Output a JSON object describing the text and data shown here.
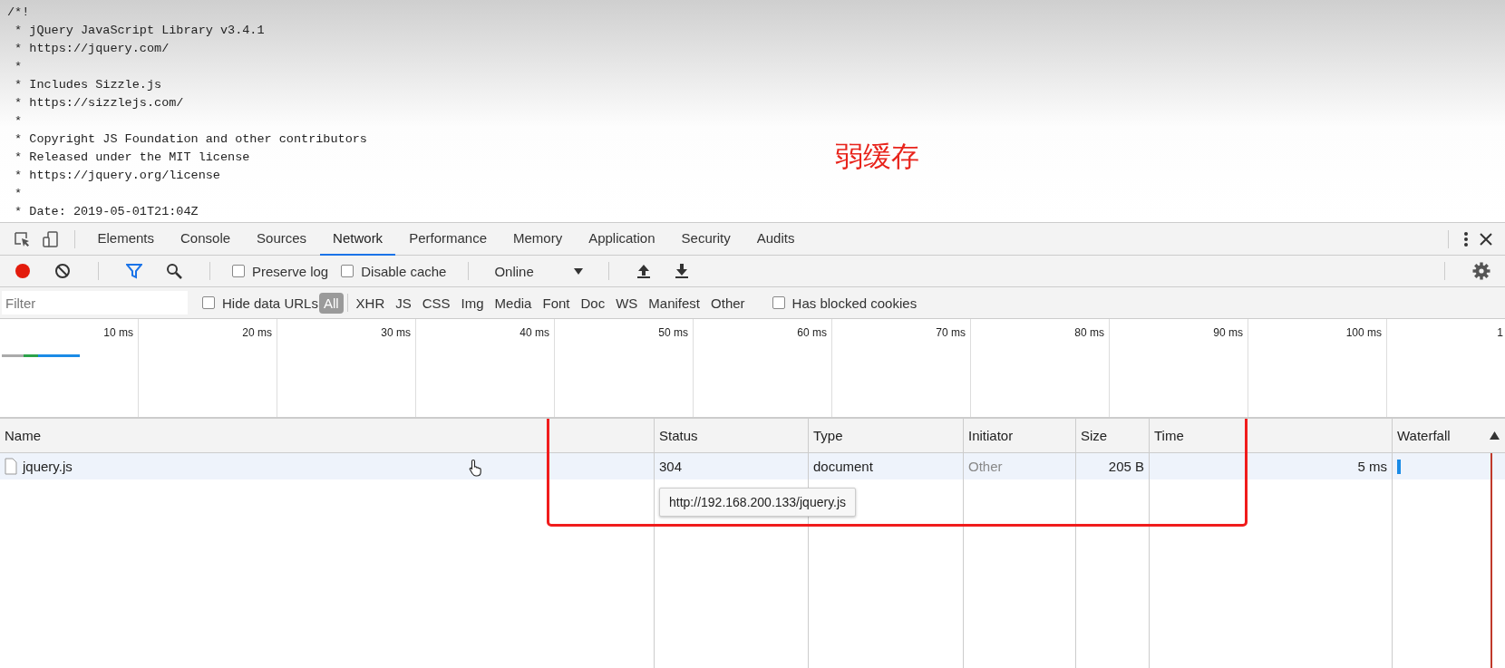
{
  "source": {
    "lines": [
      "/*!",
      " * jQuery JavaScript Library v3.4.1",
      " * https://jquery.com/",
      " *",
      " * Includes Sizzle.js",
      " * https://sizzlejs.com/",
      " *",
      " * Copyright JS Foundation and other contributors",
      " * Released under the MIT license",
      " * https://jquery.org/license",
      " *",
      " * Date: 2019-05-01T21:04Z"
    ]
  },
  "annotation": {
    "text": "弱缓存"
  },
  "devtools": {
    "tabs": [
      {
        "label": "Elements",
        "selected": false
      },
      {
        "label": "Console",
        "selected": false
      },
      {
        "label": "Sources",
        "selected": false
      },
      {
        "label": "Network",
        "selected": true
      },
      {
        "label": "Performance",
        "selected": false
      },
      {
        "label": "Memory",
        "selected": false
      },
      {
        "label": "Application",
        "selected": false
      },
      {
        "label": "Security",
        "selected": false
      },
      {
        "label": "Audits",
        "selected": false
      }
    ],
    "toolbar": {
      "recording": true,
      "preserve_log": {
        "label": "Preserve log",
        "checked": false
      },
      "disable_cache": {
        "label": "Disable cache",
        "checked": false
      },
      "throttling": "Online"
    },
    "filter": {
      "placeholder": "Filter",
      "hide_data_urls": {
        "label": "Hide data URLs",
        "checked": false
      },
      "types": [
        {
          "label": "All",
          "selected": true
        },
        {
          "label": "XHR",
          "selected": false
        },
        {
          "label": "JS",
          "selected": false
        },
        {
          "label": "CSS",
          "selected": false
        },
        {
          "label": "Img",
          "selected": false
        },
        {
          "label": "Media",
          "selected": false
        },
        {
          "label": "Font",
          "selected": false
        },
        {
          "label": "Doc",
          "selected": false
        },
        {
          "label": "WS",
          "selected": false
        },
        {
          "label": "Manifest",
          "selected": false
        },
        {
          "label": "Other",
          "selected": false
        }
      ],
      "has_blocked_cookies": {
        "label": "Has blocked cookies",
        "checked": false
      }
    },
    "timeline": {
      "ticks": [
        "10 ms",
        "20 ms",
        "30 ms",
        "40 ms",
        "50 ms",
        "60 ms",
        "70 ms",
        "80 ms",
        "90 ms",
        "100 ms",
        "1"
      ]
    },
    "table": {
      "columns": [
        "Name",
        "Status",
        "Type",
        "Initiator",
        "Size",
        "Time",
        "Waterfall"
      ],
      "rows": [
        {
          "name": "jquery.js",
          "status": "304",
          "type": "document",
          "initiator": "Other",
          "size": "205 B",
          "time": "5 ms",
          "selected": true
        }
      ]
    },
    "tooltip": "http://192.168.200.133/jquery.js"
  }
}
